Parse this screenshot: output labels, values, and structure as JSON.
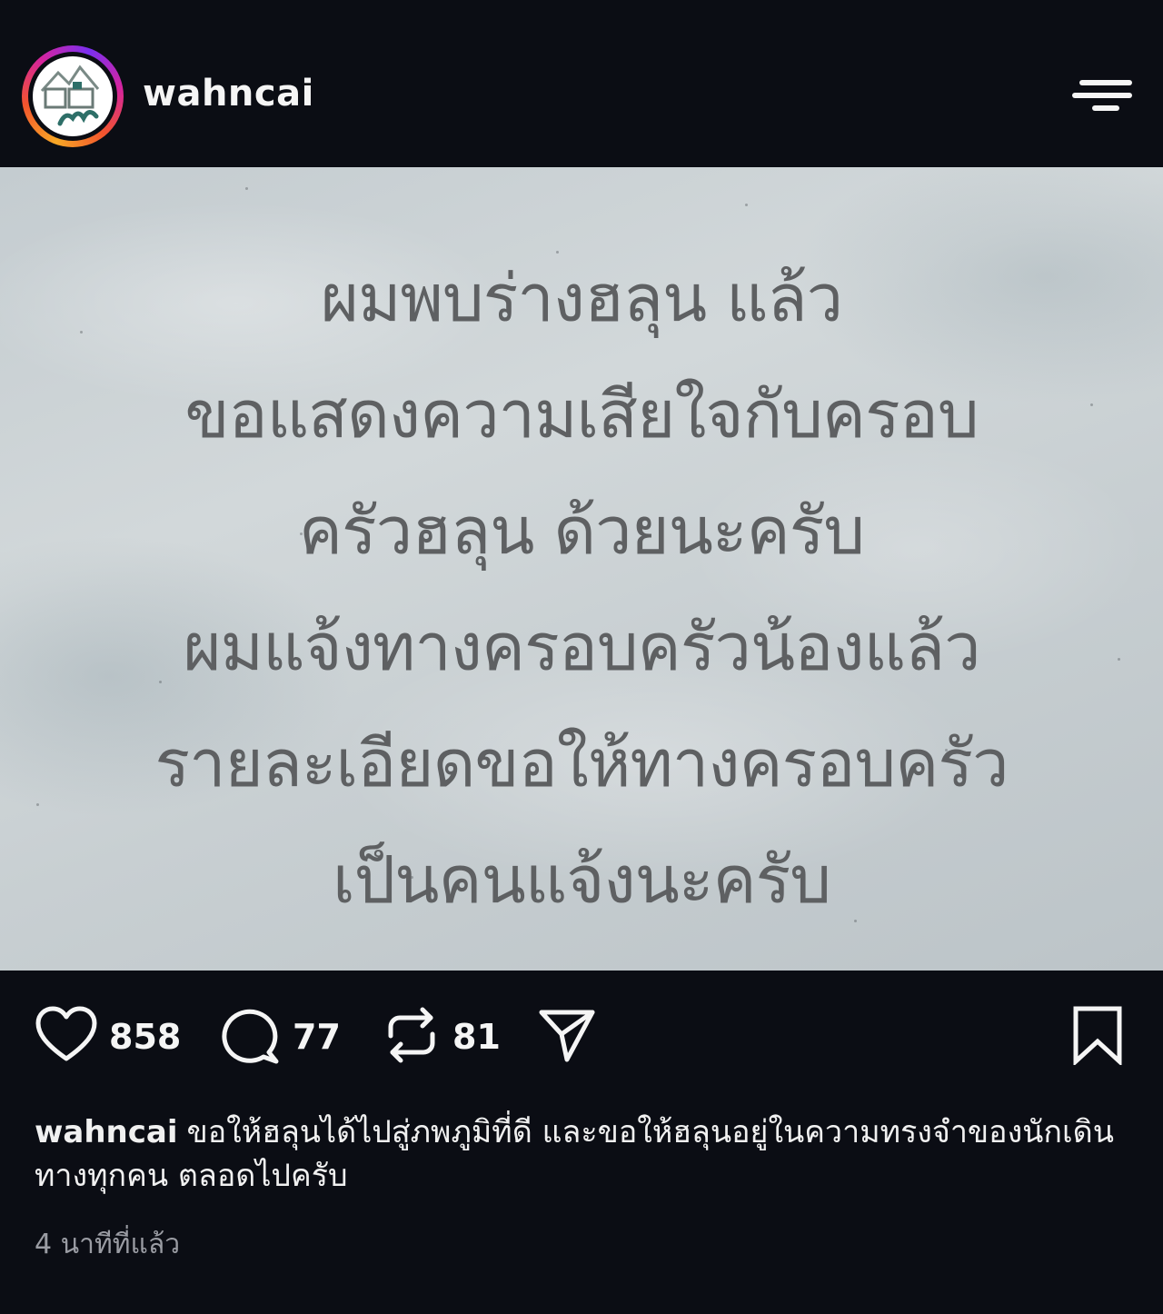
{
  "header": {
    "username": "wahncai",
    "avatar_icon": "profile-logo-icon",
    "menu_icon": "menu-icon"
  },
  "post": {
    "image_lines": [
      "ผมพบร่างฮลุน แล้ว",
      "ขอแสดงความเสียใจกับครอบ",
      "ครัวฮลุน ด้วยนะครับ",
      "ผมแจ้งทางครอบครัวน้องแล้ว",
      "รายละเอียดขอให้ทางครอบครัว",
      "เป็นคนแจ้งนะครับ"
    ]
  },
  "actions": {
    "likes": "858",
    "comments": "77",
    "reposts": "81",
    "like_icon": "heart-icon",
    "comment_icon": "comment-icon",
    "repost_icon": "repost-icon",
    "share_icon": "share-icon",
    "save_icon": "bookmark-icon"
  },
  "caption": {
    "username": "wahncai",
    "text": "ขอให้ฮลุนได้ไปสู่ภพภูมิที่ดี และขอให้ฮลุนอยู่ในความทรงจำของนักเดินทางทุกคน ตลอดไปครับ"
  },
  "timestamp": "4 นาทีที่แล้ว",
  "colors": {
    "background": "#0b0d14",
    "text": "#f5f5f5",
    "muted": "#9a9ca3",
    "post_text": "#5e6062"
  }
}
